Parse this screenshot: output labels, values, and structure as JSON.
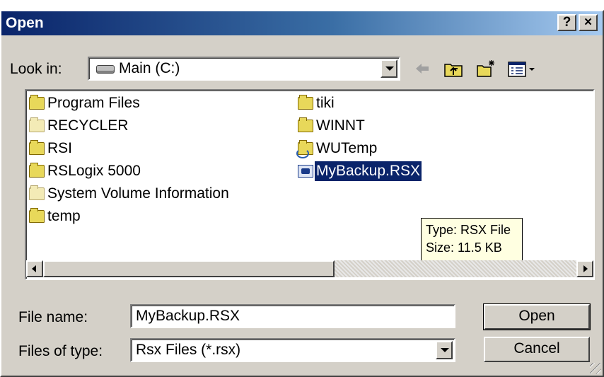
{
  "window": {
    "title": "Open",
    "help_label": "?",
    "close_label": "×"
  },
  "lookin": {
    "label": "Look in:",
    "value": "Main (C:)"
  },
  "toolbar": {
    "back_icon": "back-arrow-icon",
    "up_icon": "up-folder-icon",
    "new_folder_icon": "new-folder-icon",
    "view_icon": "view-menu-icon"
  },
  "files": {
    "column1": [
      {
        "name": "Program Files",
        "icon": "folder-icon"
      },
      {
        "name": "RECYCLER",
        "icon": "folder-hidden-icon"
      },
      {
        "name": "RSI",
        "icon": "folder-icon"
      },
      {
        "name": "RSLogix 5000",
        "icon": "folder-icon"
      },
      {
        "name": "System Volume Information",
        "icon": "folder-hidden-icon"
      },
      {
        "name": "temp",
        "icon": "folder-icon"
      }
    ],
    "column2": [
      {
        "name": "tiki",
        "icon": "folder-icon"
      },
      {
        "name": "WINNT",
        "icon": "folder-icon"
      },
      {
        "name": "WUTemp",
        "icon": "folder-shared-icon"
      },
      {
        "name": "MyBackup.RSX",
        "icon": "rsx-file-icon",
        "selected": true
      }
    ]
  },
  "tooltip": {
    "type_line": "Type: RSX File",
    "size_line": "Size: 11.5 KB"
  },
  "filename": {
    "label": "File name:",
    "value": "MyBackup.RSX"
  },
  "filetype": {
    "label": "Files of type:",
    "value": "Rsx Files (*.rsx)"
  },
  "buttons": {
    "open": "Open",
    "cancel": "Cancel"
  },
  "colors": {
    "title_start": "#0a246a",
    "title_end": "#a6caf0",
    "face": "#d4d0c8",
    "selection": "#0a246a",
    "tooltip_bg": "#ffffe1"
  }
}
